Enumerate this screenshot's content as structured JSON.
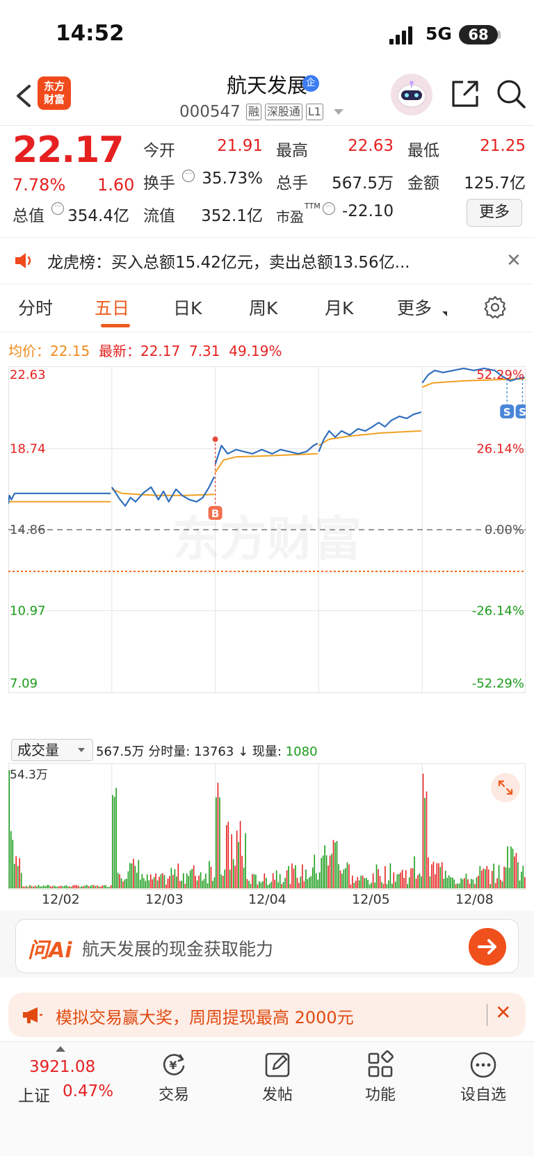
{
  "status": {
    "time": "14:52",
    "network": "5G",
    "battery": "68"
  },
  "header": {
    "logo_line1": "东方",
    "logo_line2": "财富",
    "name": "航天发展",
    "badge": "企",
    "code": "000547",
    "tags": [
      "融",
      "深股通",
      "L1"
    ]
  },
  "quote": {
    "price": "22.17",
    "pct": "7.78%",
    "change": "1.60",
    "open_label": "今开",
    "open": "21.91",
    "high_label": "最高",
    "high": "22.63",
    "low_label": "最低",
    "low": "21.25",
    "turnover_label": "换手",
    "turnover": "35.73%",
    "volume_label": "总手",
    "volume": "567.5万",
    "amount_label": "金额",
    "amount": "125.7亿",
    "mcap_label": "总值",
    "mcap": "354.4亿",
    "float_label": "流值",
    "float": "352.1亿",
    "pe_label": "市盈",
    "pe_sup": "TTM",
    "pe": "-22.10",
    "more": "更多"
  },
  "notice": {
    "text": "龙虎榜：买入总额15.42亿元，卖出总额13.56亿..."
  },
  "tabs": [
    "分时",
    "五日",
    "日K",
    "周K",
    "月K",
    "更多"
  ],
  "info_row": {
    "avg_label": "均价：",
    "avg": "22.15",
    "latest_label": "最新：",
    "latest": "22.17",
    "latest_chg": "7.31",
    "latest_pct": "49.19%"
  },
  "chart_data": {
    "type": "line",
    "x_labels": [
      "12/02",
      "12/03",
      "12/04",
      "12/05",
      "12/08"
    ],
    "y_ticks_left": [
      "22.63",
      "18.74",
      "14.86",
      "10.97",
      "7.09"
    ],
    "y_ticks_right": [
      "52.29%",
      "26.14%",
      "0.00%",
      "-26.14%",
      "-52.29%"
    ],
    "ylim": [
      7.09,
      22.63
    ],
    "base_price": 14.86,
    "watermark": "东方财富",
    "markers": [
      {
        "label": "B",
        "day": 2,
        "price": 19.2
      },
      {
        "label": "S",
        "day": 4.82,
        "price": 21.8
      },
      {
        "label": "S",
        "day": 4.97,
        "price": 21.8
      }
    ],
    "series": [
      {
        "name": "price",
        "color": "#2f6ebd",
        "points": [
          [
            0.0,
            16.1
          ],
          [
            0.01,
            16.5
          ],
          [
            0.03,
            16.3
          ],
          [
            0.06,
            16.6
          ],
          [
            0.99,
            16.6
          ],
          [
            1.0,
            16.9
          ],
          [
            1.04,
            16.6
          ],
          [
            1.08,
            16.3
          ],
          [
            1.13,
            16.0
          ],
          [
            1.18,
            16.4
          ],
          [
            1.23,
            16.2
          ],
          [
            1.3,
            16.6
          ],
          [
            1.38,
            16.9
          ],
          [
            1.45,
            16.3
          ],
          [
            1.5,
            16.7
          ],
          [
            1.55,
            16.2
          ],
          [
            1.62,
            16.8
          ],
          [
            1.68,
            16.5
          ],
          [
            1.75,
            16.3
          ],
          [
            1.82,
            16.2
          ],
          [
            1.88,
            16.4
          ],
          [
            1.94,
            16.9
          ],
          [
            1.99,
            17.4
          ],
          [
            2.0,
            18.0
          ],
          [
            2.06,
            18.9
          ],
          [
            2.12,
            18.5
          ],
          [
            2.2,
            18.7
          ],
          [
            2.28,
            18.6
          ],
          [
            2.36,
            18.5
          ],
          [
            2.45,
            18.7
          ],
          [
            2.55,
            18.5
          ],
          [
            2.63,
            18.7
          ],
          [
            2.72,
            18.6
          ],
          [
            2.8,
            18.5
          ],
          [
            2.88,
            18.6
          ],
          [
            2.95,
            18.9
          ],
          [
            2.99,
            19.0
          ],
          [
            3.0,
            18.6
          ],
          [
            3.05,
            19.2
          ],
          [
            3.1,
            19.6
          ],
          [
            3.16,
            19.3
          ],
          [
            3.22,
            19.6
          ],
          [
            3.3,
            19.4
          ],
          [
            3.38,
            19.7
          ],
          [
            3.45,
            19.6
          ],
          [
            3.52,
            19.8
          ],
          [
            3.58,
            20.0
          ],
          [
            3.64,
            19.8
          ],
          [
            3.7,
            20.1
          ],
          [
            3.78,
            20.3
          ],
          [
            3.85,
            20.2
          ],
          [
            3.92,
            20.4
          ],
          [
            3.99,
            20.5
          ],
          [
            4.0,
            21.9
          ],
          [
            4.06,
            22.3
          ],
          [
            4.12,
            22.5
          ],
          [
            4.2,
            22.4
          ],
          [
            4.3,
            22.5
          ],
          [
            4.4,
            22.6
          ],
          [
            4.5,
            22.5
          ],
          [
            4.6,
            22.6
          ],
          [
            4.7,
            22.5
          ],
          [
            4.78,
            22.2
          ],
          [
            4.85,
            22.0
          ],
          [
            4.92,
            22.1
          ],
          [
            4.99,
            22.17
          ]
        ]
      },
      {
        "name": "avg",
        "color": "#f0a020",
        "points": [
          [
            0.0,
            16.2
          ],
          [
            0.99,
            16.2
          ],
          [
            1.0,
            16.8
          ],
          [
            1.1,
            16.6
          ],
          [
            1.25,
            16.55
          ],
          [
            1.45,
            16.5
          ],
          [
            1.7,
            16.5
          ],
          [
            1.99,
            16.55
          ],
          [
            2.0,
            17.6
          ],
          [
            2.08,
            18.2
          ],
          [
            2.2,
            18.35
          ],
          [
            2.5,
            18.4
          ],
          [
            2.99,
            18.5
          ],
          [
            3.0,
            18.9
          ],
          [
            3.1,
            19.2
          ],
          [
            3.3,
            19.35
          ],
          [
            3.6,
            19.5
          ],
          [
            3.99,
            19.6
          ],
          [
            4.0,
            21.7
          ],
          [
            4.1,
            21.9
          ],
          [
            4.4,
            22.0
          ],
          [
            4.99,
            22.1
          ]
        ]
      }
    ]
  },
  "volume": {
    "selector": "成交量",
    "total": "567.5万",
    "tick_label": "分时量:",
    "tick_value": "13763",
    "current_label": "现量:",
    "current_value": "1080",
    "max_label": "54.3万"
  },
  "ai": {
    "logo": "问Ai",
    "prompt": "航天发展的现金获取能力"
  },
  "promo": {
    "text": "模拟交易赢大奖，周周提现最高 2000元"
  },
  "bottom_nav": {
    "index_value": "3921.08",
    "index_name": "上证",
    "index_pct": "0.47%",
    "items": [
      "交易",
      "发帖",
      "功能",
      "设自选"
    ]
  }
}
